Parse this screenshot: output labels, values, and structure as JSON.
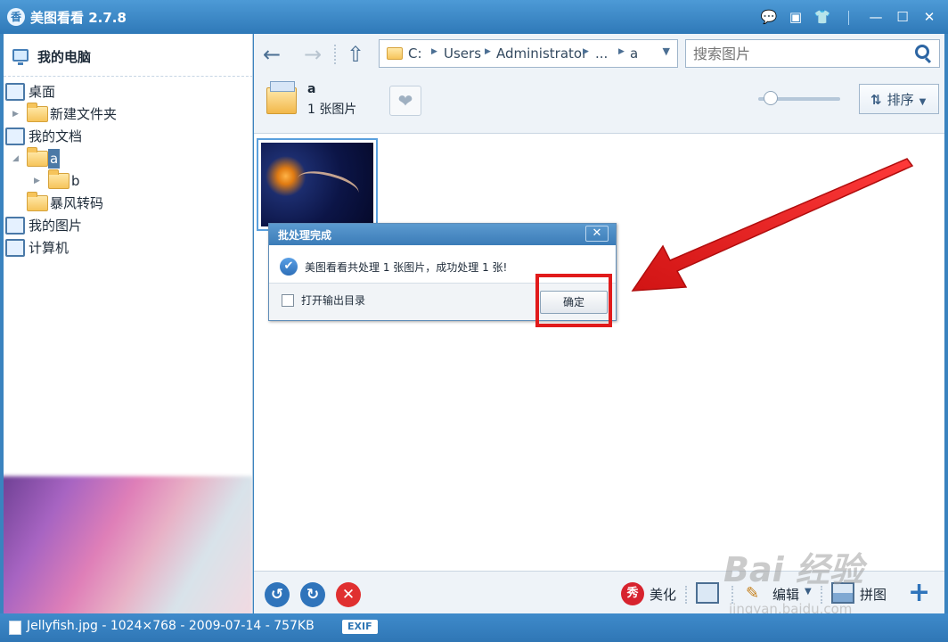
{
  "app": {
    "icon_glyph": "香",
    "title": "美图看看 2.7.8"
  },
  "titlebar_buttons": {
    "feedback": "💬",
    "menu": "▣",
    "skin": "👕",
    "minimize": "—",
    "maximize": "☐",
    "close": "✕"
  },
  "sidebar": {
    "header": "我的电脑",
    "items": [
      {
        "label": "桌面"
      },
      {
        "label": "新建文件夹"
      },
      {
        "label": "我的文档"
      },
      {
        "label": "a"
      },
      {
        "label": "b"
      },
      {
        "label": "暴风转码"
      },
      {
        "label": "我的图片"
      },
      {
        "label": "计算机"
      }
    ]
  },
  "nav": {
    "back": "←",
    "forward": "→",
    "up": "⇧",
    "path": [
      "C:",
      "Users",
      "Administrator",
      "...",
      "a"
    ],
    "search_placeholder": "搜索图片"
  },
  "folder": {
    "name": "a",
    "count": "1 张图片",
    "fav_glyph": "❤",
    "sort_icon": "⇅",
    "sort_label": "排序",
    "zoom_level": 0.15
  },
  "dialog": {
    "title": "批处理完成",
    "close": "✕",
    "message": "美图看看共处理 1 张图片，成功处理 1 张!",
    "checkbox_label": "打开输出目录",
    "ok": "确定"
  },
  "bottombar": {
    "rotate_left": "↺",
    "rotate_right": "↻",
    "delete": "✕",
    "beautify_glyph": "秀",
    "beautify_label": "美化",
    "edit_glyph": "✎",
    "edit_label": "编辑",
    "collage_label": "拼图",
    "add": "+"
  },
  "statusbar": {
    "file_info": "Jellyfish.jpg - 1024×768 - 2009-07-14 - 757KB",
    "exif": "EXIF"
  },
  "watermark": {
    "main": "Bai 经验",
    "sub": "jingyan.baidu.com"
  },
  "colors": {
    "accent": "#2f79b8",
    "highlight": "#e11b1b"
  }
}
